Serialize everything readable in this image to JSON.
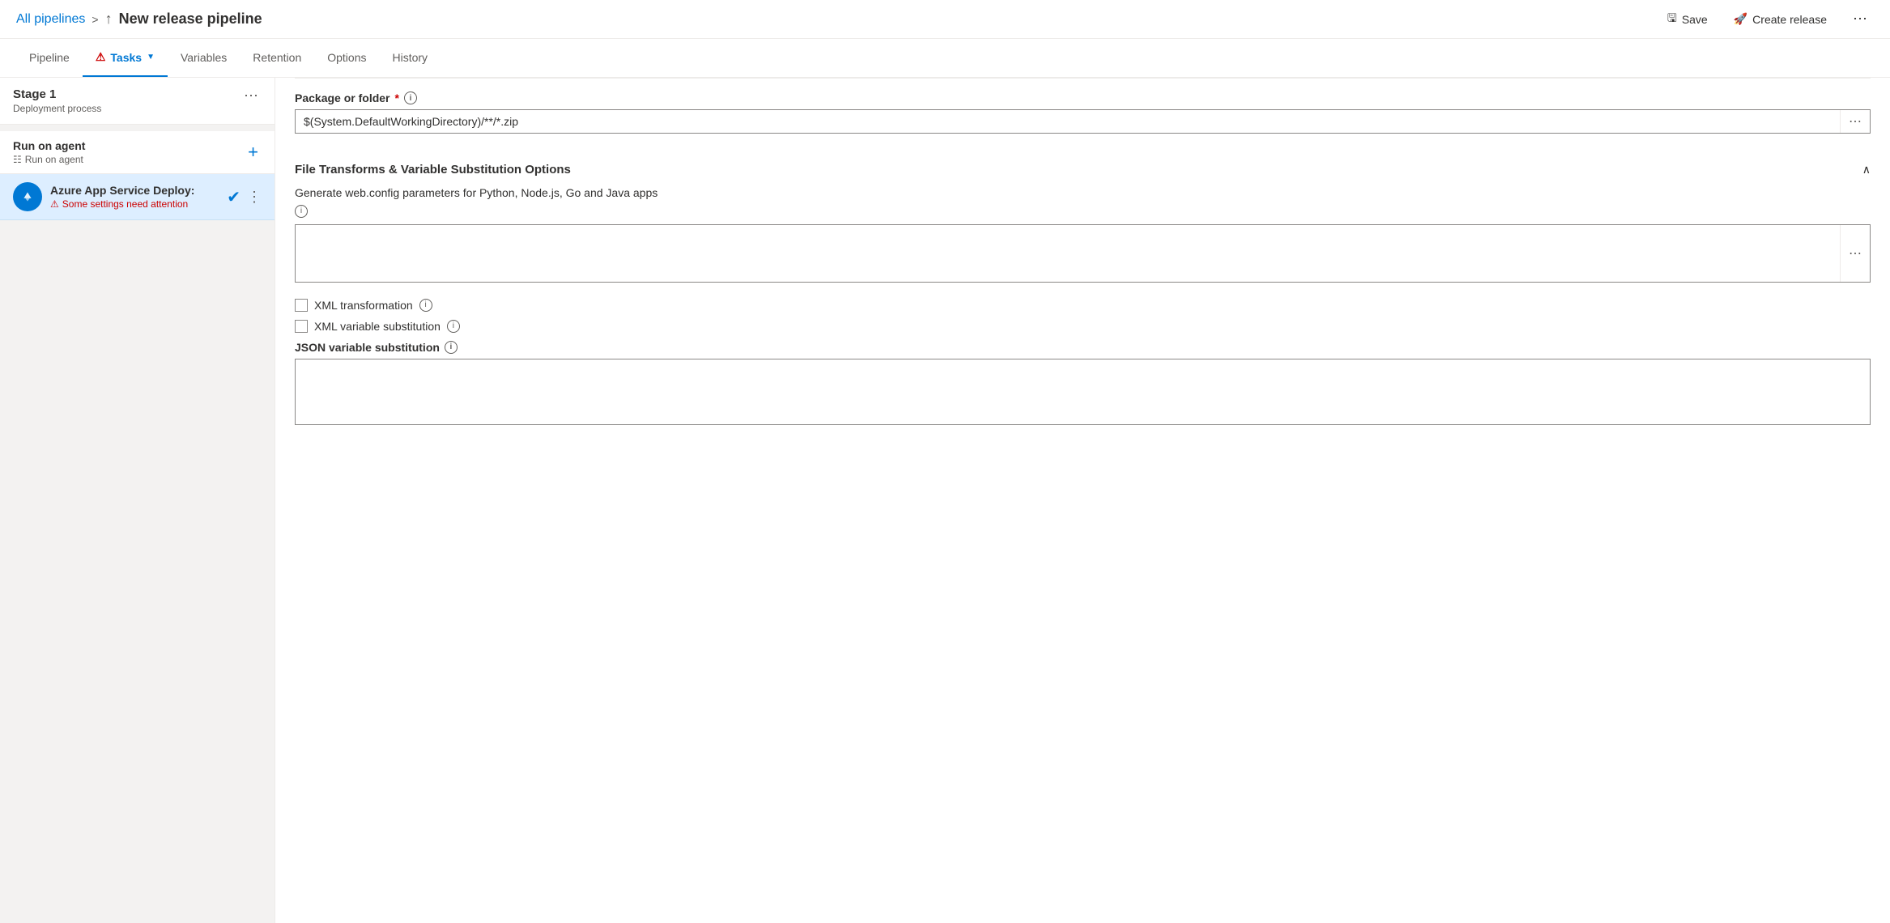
{
  "header": {
    "breadcrumb_link": "All pipelines",
    "breadcrumb_sep": ">",
    "title": "New release pipeline",
    "save_label": "Save",
    "create_release_label": "Create release",
    "more_label": "..."
  },
  "tabs": [
    {
      "id": "pipeline",
      "label": "Pipeline",
      "active": false,
      "warning": false
    },
    {
      "id": "tasks",
      "label": "Tasks",
      "active": true,
      "warning": true
    },
    {
      "id": "variables",
      "label": "Variables",
      "active": false,
      "warning": false
    },
    {
      "id": "retention",
      "label": "Retention",
      "active": false,
      "warning": false
    },
    {
      "id": "options",
      "label": "Options",
      "active": false,
      "warning": false
    },
    {
      "id": "history",
      "label": "History",
      "active": false,
      "warning": false
    }
  ],
  "left_panel": {
    "stage": {
      "title": "Stage 1",
      "subtitle": "Deployment process"
    },
    "run_on_agent": {
      "label": "Run on agent",
      "sublabel": "Run on agent"
    },
    "task": {
      "name": "Azure App Service Deploy:",
      "warning": "Some settings need attention"
    }
  },
  "right_panel": {
    "package_field": {
      "label": "Package or folder",
      "required": true,
      "value": "$(System.DefaultWorkingDirectory)/**/*.zip",
      "more": "..."
    },
    "file_transforms_section": {
      "title": "File Transforms & Variable Substitution Options",
      "collapsed": false
    },
    "generate_webconfig": {
      "label_main": "Generate web.config parameters for Python, Node.js, Go and Java apps",
      "value": "",
      "more": "..."
    },
    "xml_transformation": {
      "label": "XML transformation",
      "checked": false
    },
    "xml_variable_substitution": {
      "label": "XML variable substitution",
      "checked": false
    },
    "json_variable_substitution": {
      "label": "JSON variable substitution",
      "value": ""
    }
  }
}
